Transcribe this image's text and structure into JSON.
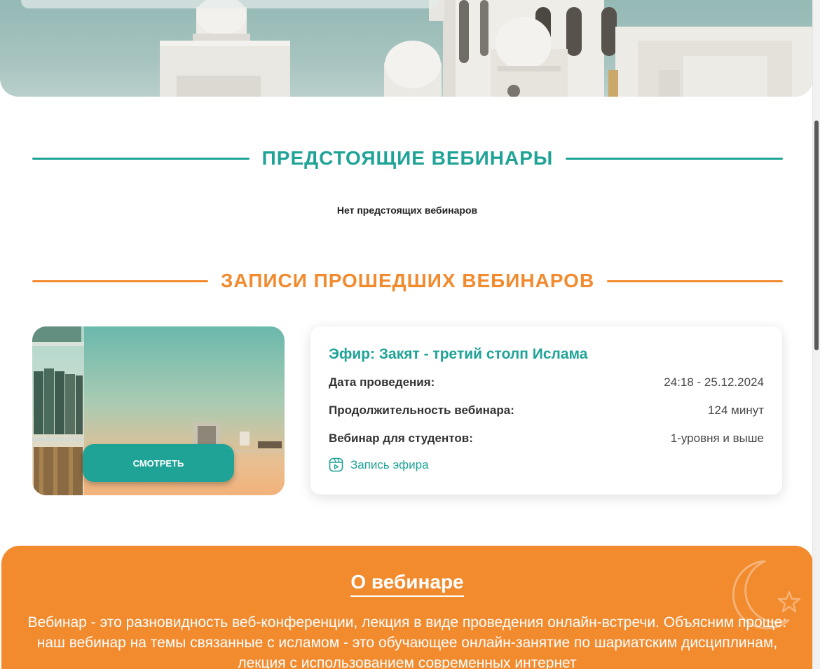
{
  "upcoming": {
    "title": "ПРЕДСТОЯЩИЕ ВЕБИНАРЫ",
    "empty_text": "Нет предстоящих вебинаров"
  },
  "past": {
    "title": "ЗАПИСИ ПРОШЕДШИХ ВЕБИНАРОВ",
    "webinar": {
      "watch_label": "СМОТРЕТЬ",
      "title": "Эфир: Закят - третий столп Ислама",
      "rows": [
        {
          "label": "Дата проведения:",
          "value": "24:18 - 25.12.2024"
        },
        {
          "label": "Продолжительность вебинара:",
          "value": "124 минут"
        },
        {
          "label": "Вебинар для студентов:",
          "value": "1-уровня и выше"
        }
      ],
      "record_link": "Запись эфира",
      "record_icon": "video-recording-icon"
    }
  },
  "about": {
    "title": "О вебинаре",
    "text": "Вебинар - это разновидность веб-конференции, лекция в виде проведения онлайн-встречи. Объясним проще: наш вебинар на темы связанные с исламом - это обучающее онлайн-занятие по шариатским дисциплинам, лекция с использованием современных интернет",
    "decoration_icon": "crescent-star-icon"
  },
  "colors": {
    "teal": "#1fa397",
    "orange": "#f28a2e"
  }
}
